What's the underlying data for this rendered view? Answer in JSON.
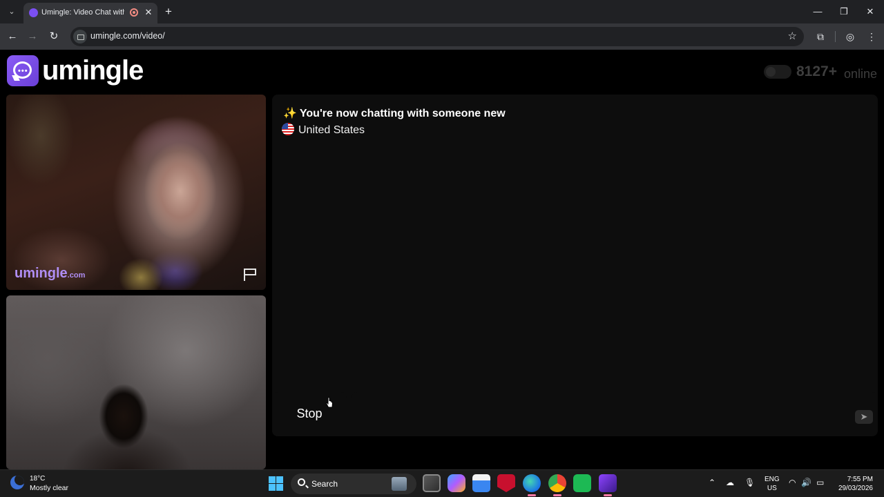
{
  "browser": {
    "tab_title": "Umingle: Video Chat with St",
    "tab_close": "✕",
    "new_tab": "+",
    "url": "umingle.com/video/",
    "window_controls": {
      "minimize": "—",
      "maximize": "❐",
      "close": "✕"
    },
    "nav": {
      "back": "←",
      "forward": "→",
      "reload": "↻"
    },
    "icons": {
      "star": "☆",
      "extensions": "⧉",
      "profile": "◎",
      "menu": "⋮"
    }
  },
  "site": {
    "logo_text": "umingle",
    "online_count": "8127+",
    "online_label": "online"
  },
  "remote_video": {
    "watermark": "umingle",
    "watermark_suffix": ".com"
  },
  "chat": {
    "spark_icon": "✨",
    "status_message": "You're now chatting with someone new",
    "country": "United States",
    "stop_label": "Stop",
    "message_input_value": "",
    "send_icon": "➤"
  },
  "taskbar": {
    "temperature": "18°C",
    "weather": "Mostly clear",
    "search_label": "Search",
    "language_line1": "ENG",
    "language_line2": "US",
    "time": "7:55 PM",
    "date": "29/03/2026",
    "tray_icons": {
      "chevron": "⌃",
      "cloud": "☁",
      "mic": "🎙",
      "wifi": "◠",
      "volume": "🔊",
      "battery": "▭"
    }
  },
  "colors": {
    "brand": "#7b4ff2",
    "chat_panel": "#0d0d0d",
    "page_bg": "#000000",
    "taskbar_bg": "#1c1c1c"
  }
}
